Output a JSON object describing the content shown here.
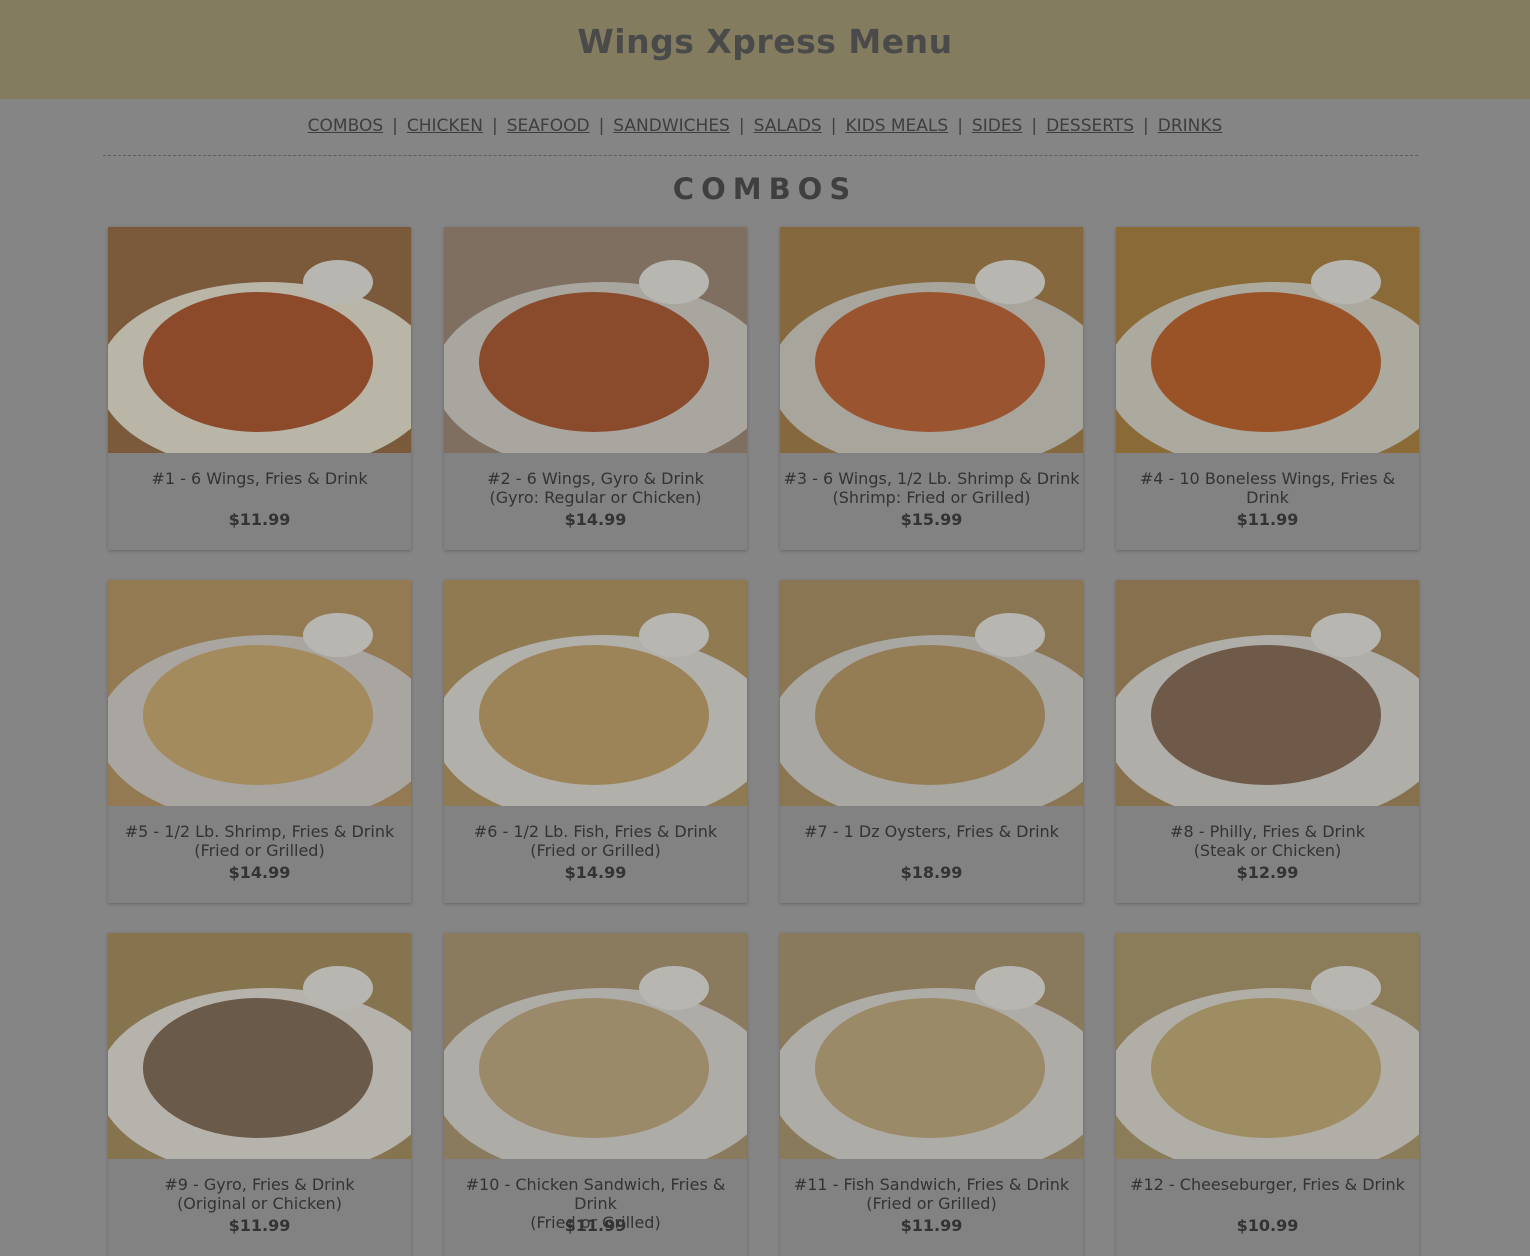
{
  "header": {
    "title": "Wings Xpress Menu"
  },
  "nav": {
    "items": [
      "COMBOS",
      "CHICKEN",
      "SEAFOOD",
      "SANDWICHES",
      "SALADS",
      "KIDS MEALS",
      "SIDES",
      "DESSERTS",
      "DRINKS"
    ],
    "separator": "|"
  },
  "section": {
    "title": "COMBOS"
  },
  "combos": [
    {
      "name": "#1 - 6 Wings, Fries & Drink",
      "price": "$11.99",
      "image": "wings-fries-ranch"
    },
    {
      "name": "#2 - 6 Wings, Gyro & Drink\n(Gyro: Regular or Chicken)",
      "price": "$14.99",
      "image": "wings-gyro"
    },
    {
      "name": "#3 - 6 Wings, 1/2 Lb. Shrimp & Drink\n(Shrimp: Fried or Grilled)",
      "price": "$15.99",
      "image": "wings-shrimp"
    },
    {
      "name": "#4 - 10 Boneless Wings, Fries & Drink",
      "price": "$11.99",
      "image": "boneless-wings"
    },
    {
      "name": "#5 - 1/2 Lb. Shrimp, Fries & Drink\n(Fried or Grilled)",
      "price": "$14.99",
      "image": "shrimp-fries"
    },
    {
      "name": "#6 - 1/2 Lb. Fish, Fries & Drink\n(Fried or Grilled)",
      "price": "$14.99",
      "image": "fish-fries"
    },
    {
      "name": "#7 - 1 Dz Oysters, Fries & Drink",
      "price": "$18.99",
      "image": "oysters-fries"
    },
    {
      "name": "#8 - Philly, Fries & Drink\n(Steak or Chicken)",
      "price": "$12.99",
      "image": "philly"
    },
    {
      "name": "#9 - Gyro, Fries & Drink\n(Original or Chicken)",
      "price": "$11.99",
      "image": "gyro-fries"
    },
    {
      "name": "#10 - Chicken Sandwich, Fries & Drink\n(Fried or Grilled)",
      "price": "$11.99",
      "image": "chicken-sandwich"
    },
    {
      "name": "#11 - Fish Sandwich, Fries & Drink\n(Fried or Grilled)",
      "price": "$11.99",
      "image": "fish-sandwich"
    },
    {
      "name": "#12 - Cheeseburger, Fries & Drink",
      "price": "$10.99",
      "image": "cheeseburger"
    }
  ],
  "colors": {
    "header_bg": "#837c5f",
    "page_bg": "#858585",
    "text": "#3a3a3a"
  }
}
